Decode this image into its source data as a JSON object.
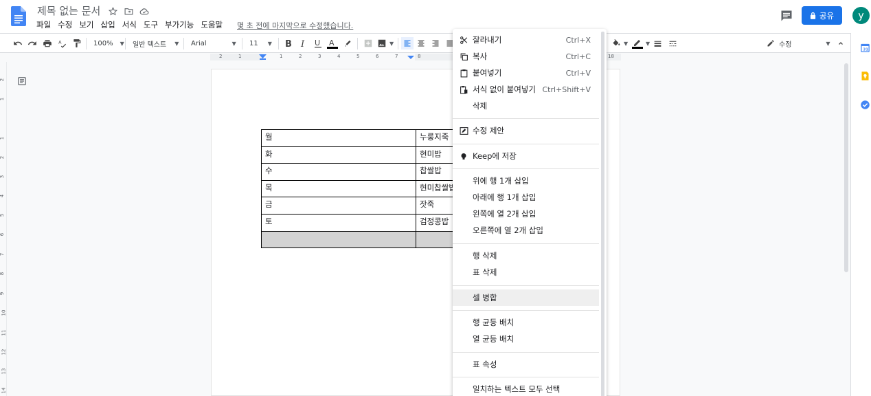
{
  "header": {
    "title": "제목 없는 문서",
    "last_edit": "몇 초 전에 마지막으로 수정했습니다.",
    "share_label": "공유",
    "avatar_letter": "y",
    "share_color": "#1a73e8",
    "avatar_color": "#00897b"
  },
  "menu": {
    "items": [
      "파일",
      "수정",
      "보기",
      "삽입",
      "서식",
      "도구",
      "부가기능",
      "도움말"
    ]
  },
  "toolbar": {
    "zoom": "100%",
    "style": "일반 텍스트",
    "font": "Arial",
    "font_size": "11",
    "edit_mode": "수정"
  },
  "ruler": {
    "h_labels": [
      "2",
      "1",
      "1",
      "2",
      "3",
      "4",
      "5",
      "6",
      "7",
      "8",
      "18"
    ],
    "v_labels": [
      "2",
      "1",
      "1",
      "2",
      "3",
      "4",
      "5",
      "6",
      "7",
      "8",
      "9",
      "10",
      "11",
      "12",
      "13",
      "14"
    ]
  },
  "table": {
    "rows": [
      [
        "월",
        "누룽지죽"
      ],
      [
        "화",
        "현미밥"
      ],
      [
        "수",
        "찹쌀밥"
      ],
      [
        "목",
        "현미찹쌀밥"
      ],
      [
        "금",
        "잣죽"
      ],
      [
        "토",
        "검정콩밥"
      ],
      [
        "",
        ""
      ]
    ]
  },
  "context_menu": {
    "cut": {
      "label": "잘라내기",
      "shortcut": "Ctrl+X"
    },
    "copy": {
      "label": "복사",
      "shortcut": "Ctrl+C"
    },
    "paste": {
      "label": "붙여넣기",
      "shortcut": "Ctrl+V"
    },
    "paste_plain": {
      "label": "서식 없이 붙여넣기",
      "shortcut": "Ctrl+Shift+V"
    },
    "delete": {
      "label": "삭제"
    },
    "suggest_edit": {
      "label": "수정 제안"
    },
    "save_keep": {
      "label": "Keep에 저장"
    },
    "insert_row_above": {
      "label": "위에 행 1개 삽입"
    },
    "insert_row_below": {
      "label": "아래에 행 1개 삽입"
    },
    "insert_col_left": {
      "label": "왼쪽에 열 2개 삽입"
    },
    "insert_col_right": {
      "label": "오른쪽에 열 2개 삽입"
    },
    "delete_row": {
      "label": "행 삭제"
    },
    "delete_table": {
      "label": "표 삭제"
    },
    "merge_cells": {
      "label": "셀 병합"
    },
    "distribute_rows": {
      "label": "행 균등 배치"
    },
    "distribute_cols": {
      "label": "열 균등 배치"
    },
    "table_properties": {
      "label": "표 속성"
    },
    "select_matching": {
      "label": "일치하는 텍스트 모두 선택"
    }
  }
}
